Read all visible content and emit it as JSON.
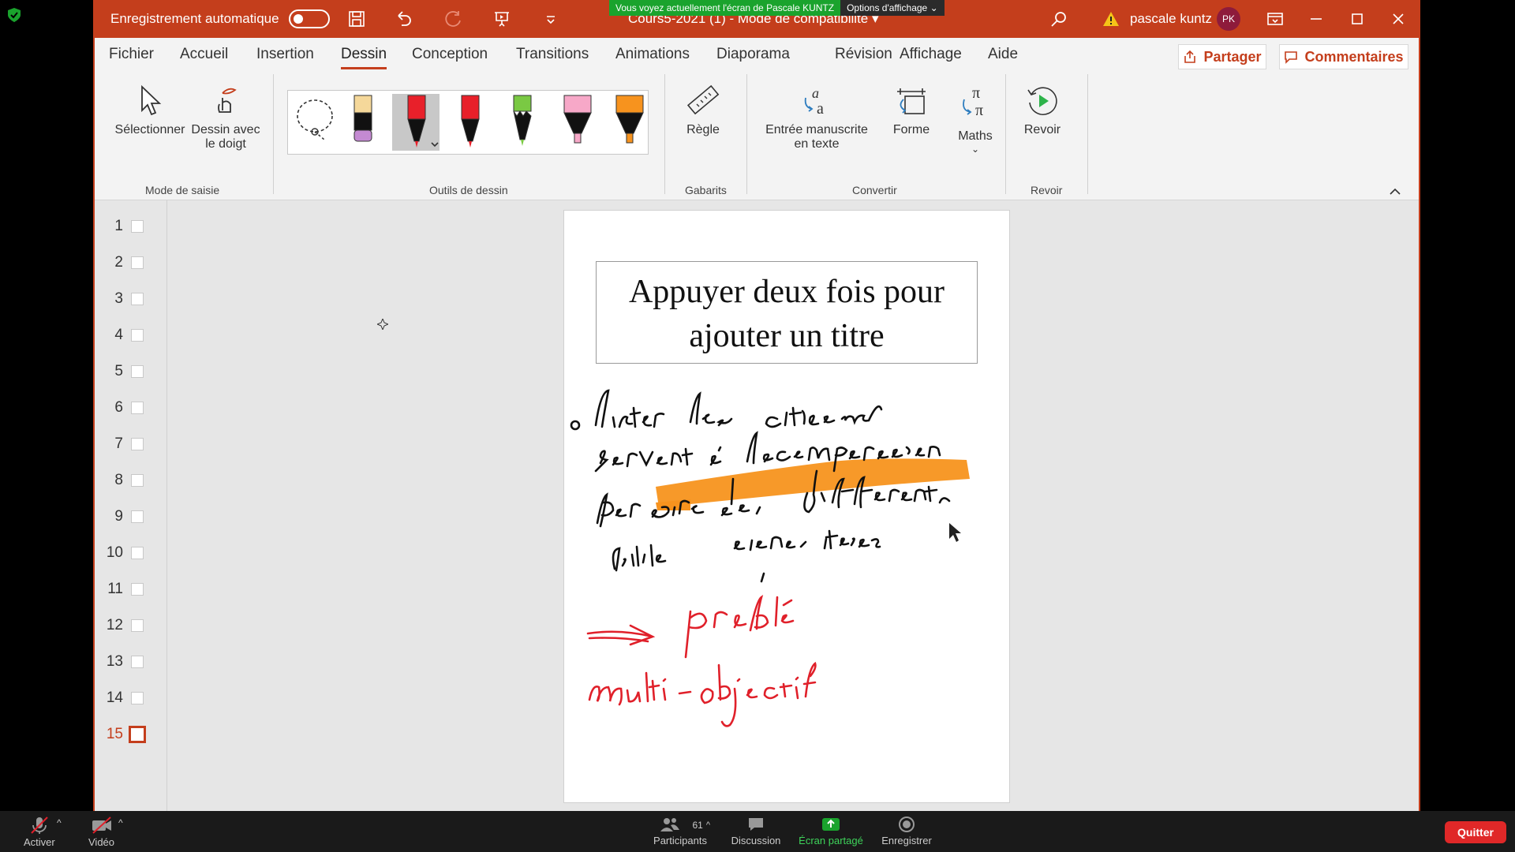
{
  "zoom_banner": {
    "message": "Vous voyez actuellement l'écran de Pascale KUNTZ",
    "options": "Options d'affichage"
  },
  "titlebar": {
    "autosave_label": "Enregistrement automatique",
    "doc_title": "Cours5-2021 (1)  -  Mode de compatibilité  ▾",
    "user_name": "pascale kuntz",
    "avatar_initials": "PK"
  },
  "tabs": [
    "Fichier",
    "Accueil",
    "Insertion",
    "Dessin",
    "Conception",
    "Transitions",
    "Animations",
    "Diaporama",
    "Révision",
    "Affichage",
    "Aide"
  ],
  "active_tab": "Dessin",
  "share_label": "Partager",
  "comments_label": "Commentaires",
  "ribbon": {
    "select_label": "Sélectionner",
    "finger_label_1": "Dessin avec",
    "finger_label_2": "le doigt",
    "group_input": "Mode de saisie",
    "group_tools": "Outils de dessin",
    "ruler_label": "Règle",
    "group_templates": "Gabarits",
    "ink_text_1": "Entrée manuscrite",
    "ink_text_2": "en texte",
    "shape_label": "Forme",
    "math_label": "Maths",
    "group_convert": "Convertir",
    "replay_label": "Revoir",
    "group_replay": "Revoir"
  },
  "pens": [
    {
      "name": "lasso",
      "color": "#ffffff"
    },
    {
      "name": "eraser",
      "color": "#f5d89a"
    },
    {
      "name": "pen-red",
      "color": "#e8202a"
    },
    {
      "name": "pen-red-2",
      "color": "#e8202a"
    },
    {
      "name": "pen-green",
      "color": "#7ac943"
    },
    {
      "name": "highlighter-pink",
      "color": "#f7a8c8"
    },
    {
      "name": "highlighter-orange",
      "color": "#f7931e"
    }
  ],
  "slides": [
    "1",
    "2",
    "3",
    "4",
    "5",
    "6",
    "7",
    "8",
    "9",
    "10",
    "11",
    "12",
    "13",
    "14",
    "15"
  ],
  "active_slide": "15",
  "slide": {
    "title_line1": "Appuyer deux fois pour",
    "title_line2": "ajouter un titre"
  },
  "zoom_bar": {
    "mute_label": "Activer",
    "video_label": "Vidéo",
    "participants_label": "Participants",
    "participants_count": "61",
    "chat_label": "Discussion",
    "share_label": "Écran partagé",
    "record_label": "Enregistrer",
    "quit_label": "Quitter"
  },
  "colors": {
    "accent": "#c43e1c",
    "ink_black": "#111111",
    "ink_red": "#e0202a",
    "highlight": "#f7931e"
  }
}
